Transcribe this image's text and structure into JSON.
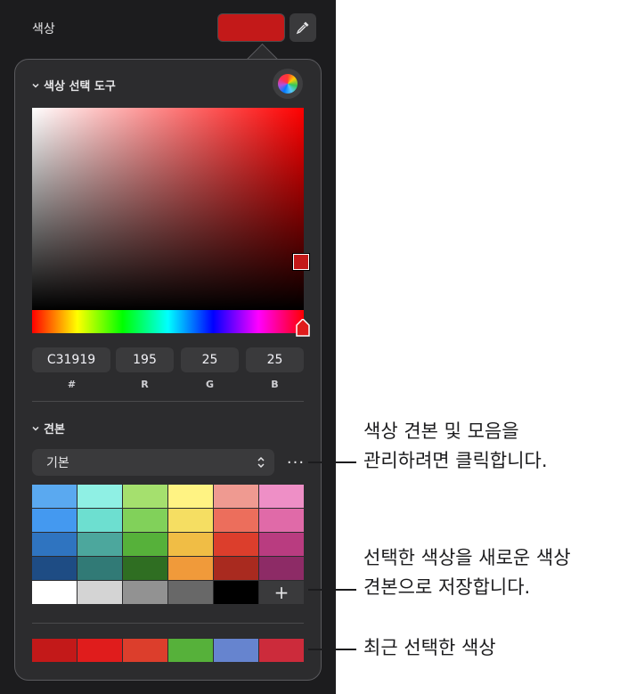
{
  "header": {
    "label": "색상",
    "current_color": "#c31919"
  },
  "picker": {
    "section_title": "색상 선택 도구",
    "hex": {
      "value": "C31919",
      "label": "#"
    },
    "r": {
      "value": "195",
      "label": "R"
    },
    "g": {
      "value": "25",
      "label": "G"
    },
    "b": {
      "value": "25",
      "label": "B"
    }
  },
  "swatches": {
    "section_title": "견본",
    "collection": "기본",
    "more_glyph": "···",
    "add_glyph": "+",
    "colors": [
      "#5aa9f0",
      "#8ff0e4",
      "#a5e06e",
      "#fff383",
      "#ef9a91",
      "#ee8fc6",
      "#4499f0",
      "#6ddfd0",
      "#81d15a",
      "#f5de62",
      "#ec6e5c",
      "#e06aa8",
      "#2f74c0",
      "#4ca79d",
      "#56b13a",
      "#f0bd45",
      "#dc3e2c",
      "#b93c80",
      "#1e4c84",
      "#317a76",
      "#2f6e22",
      "#f09a3a",
      "#a92a1f",
      "#8d2b66",
      "#ffffff",
      "#d4d4d4",
      "#929292",
      "#686868",
      "#000000"
    ],
    "recent": [
      "#c31919",
      "#e01c1c",
      "#dc3e2c",
      "#56b13a",
      "#6684cf",
      "#cc2b3b"
    ]
  },
  "callouts": {
    "manage": "색상 견본 및 모음을\n관리하려면 클릭합니다.",
    "save": "선택한 색상을 새로운 색상\n견본으로 저장합니다.",
    "recent": "최근 선택한 색상"
  }
}
